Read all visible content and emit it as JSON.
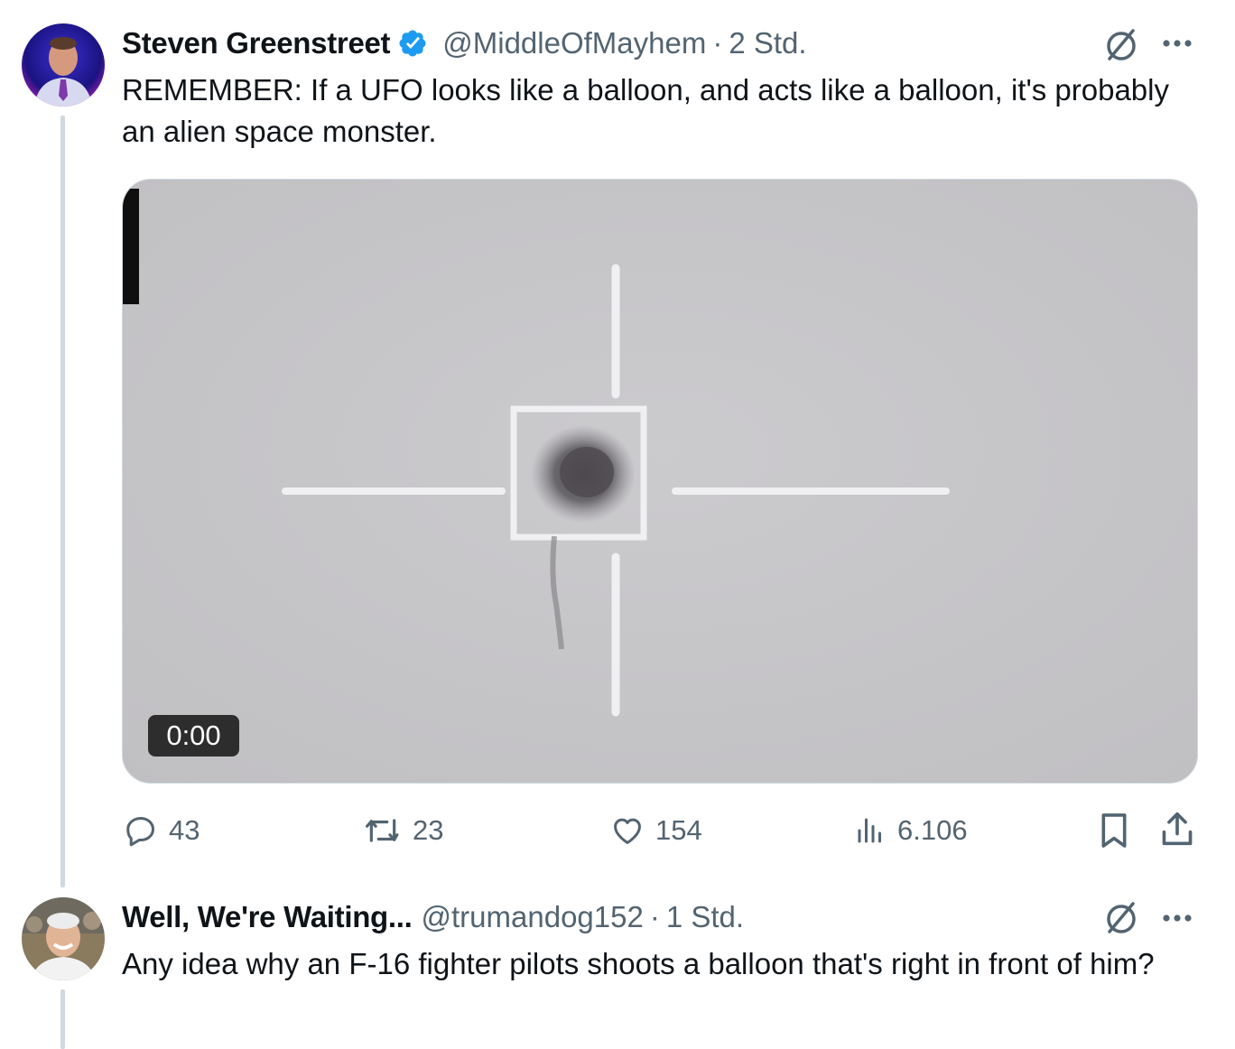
{
  "tweets": [
    {
      "author_name": "Steven Greenstreet",
      "handle": "@MiddleOfMayhem",
      "separator": "·",
      "time": "2 Std.",
      "text": "REMEMBER: If a UFO looks like a balloon, and acts like a balloon, it's probably an alien space monster.",
      "media": {
        "duration": "0:00"
      },
      "stats": {
        "replies": "43",
        "reposts": "23",
        "likes": "154",
        "views": "6.106"
      }
    },
    {
      "author_name": "Well, We're Waiting...",
      "handle": "@trumandog152",
      "separator": "·",
      "time": "1 Std.",
      "text": "Any idea why an F-16 fighter pilots shoots a balloon that's right in front of him?"
    }
  ],
  "colors": {
    "verified": "#1d9bf0",
    "secondary_text": "#536471",
    "thread_line": "#cfd9de"
  },
  "icons": [
    "verified-badge-icon",
    "grok-icon",
    "more-icon",
    "reply-icon",
    "repost-icon",
    "like-icon",
    "views-icon",
    "bookmark-icon",
    "share-icon"
  ]
}
